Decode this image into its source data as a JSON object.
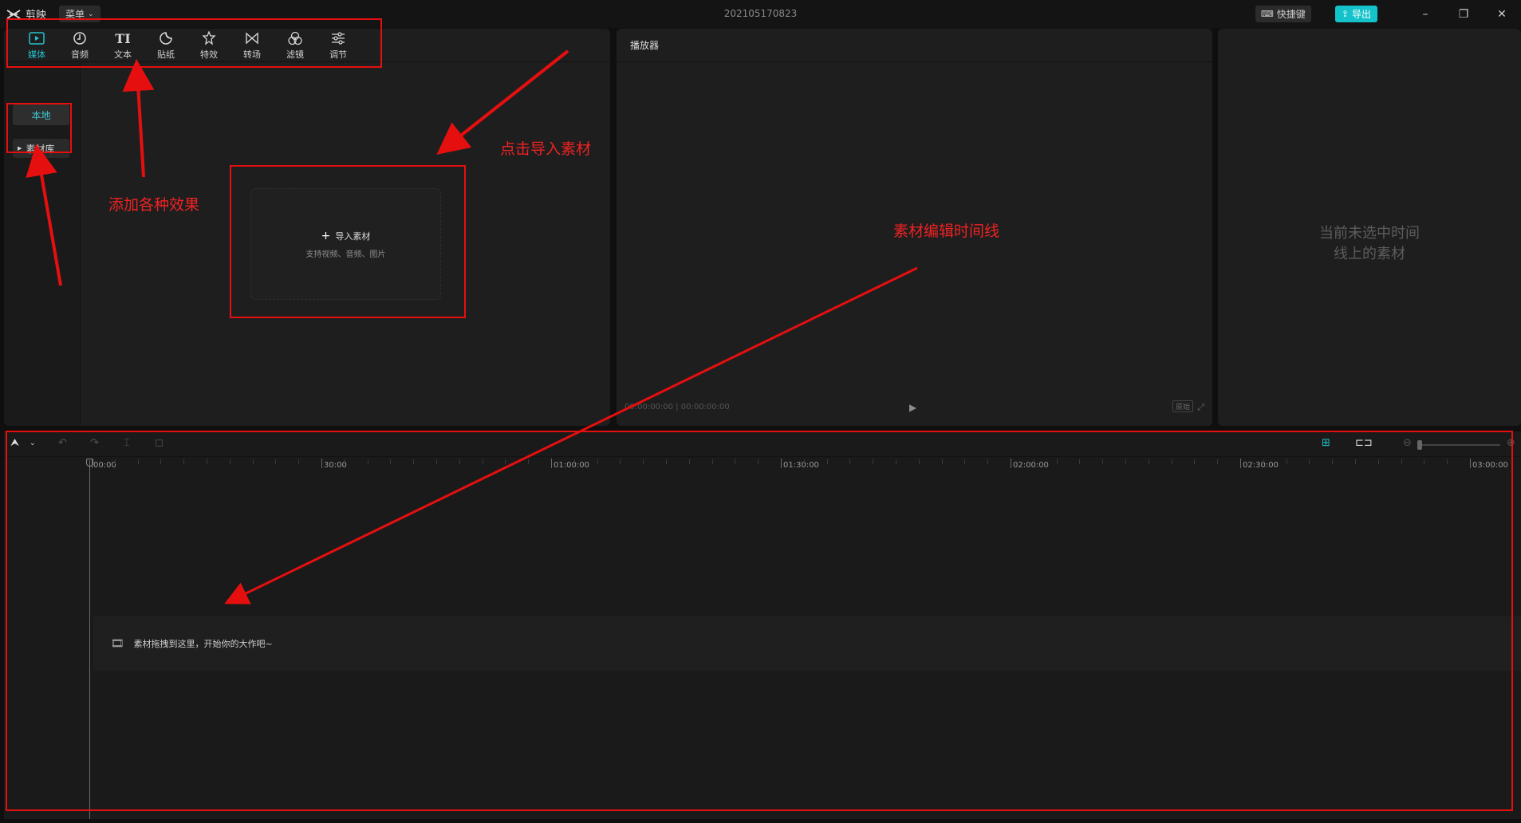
{
  "app": {
    "name": "剪映",
    "menu_label": "菜单",
    "project_title": "202105170823",
    "shortcut_label": "快捷键",
    "export_label": "导出",
    "minimize": "–",
    "restore": "❐",
    "close": "✕"
  },
  "toolbar": {
    "items": [
      {
        "label": "媒体",
        "icon": "media-icon"
      },
      {
        "label": "音频",
        "icon": "audio-icon"
      },
      {
        "label": "文本",
        "icon": "text-icon"
      },
      {
        "label": "贴纸",
        "icon": "sticker-icon"
      },
      {
        "label": "特效",
        "icon": "effects-icon"
      },
      {
        "label": "转场",
        "icon": "transition-icon"
      },
      {
        "label": "滤镜",
        "icon": "filter-icon"
      },
      {
        "label": "调节",
        "icon": "adjust-icon"
      }
    ],
    "text_glyph": "TI"
  },
  "sidebar": {
    "local_label": "本地",
    "library_label": "素材库"
  },
  "import": {
    "title": "导入素材",
    "subtitle": "支持视频、音频、图片"
  },
  "player": {
    "title": "播放器",
    "time": "00:00:00:00 | 00:00:00:00",
    "ratio_label": "原始"
  },
  "properties": {
    "empty_line1": "当前未选中时间",
    "empty_line2": "线上的素材"
  },
  "timeline": {
    "ruler_labels": [
      "00:00",
      "30:00",
      "01:00:00",
      "01:30:00",
      "02:00:00",
      "02:30:00",
      "03:00:00"
    ],
    "drop_hint": "素材拖拽到这里，开始你的大作吧~"
  },
  "annotations": {
    "effects": "添加各种效果",
    "import": "点击导入素材",
    "timeline": "素材编辑时间线"
  },
  "colors": {
    "accent": "#23c4cc",
    "annotation": "#e60f0f"
  }
}
